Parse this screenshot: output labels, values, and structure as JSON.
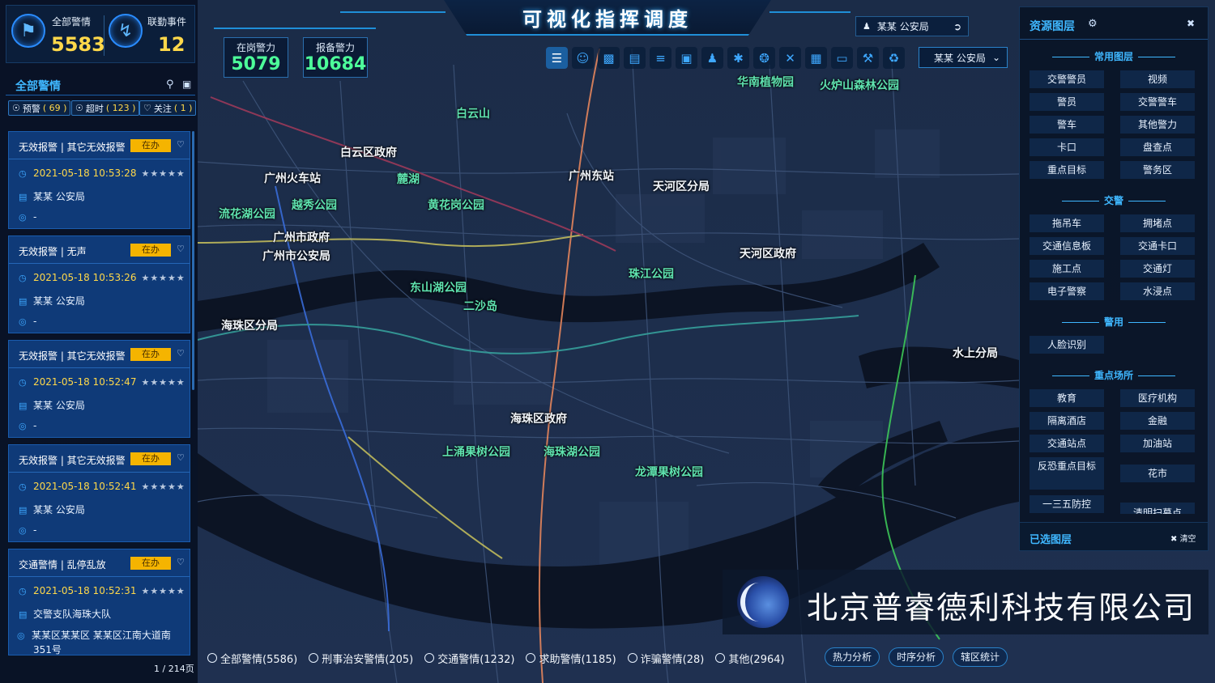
{
  "header": {
    "title": "可视化指挥调度",
    "user_label": "某某 公安局",
    "unit_select": "某某 公安局"
  },
  "stats": {
    "all_alarms_label": "全部警情",
    "all_alarms_value": "5583",
    "linked_events_label": "联勤事件",
    "linked_events_value": "12"
  },
  "police": {
    "on_duty_label": "在岗警力",
    "on_duty_value": "5079",
    "reported_label": "报备警力",
    "reported_value": "10684"
  },
  "alarm_panel": {
    "title": "全部警情",
    "filters": [
      {
        "label": "预警",
        "count": "( 69 )"
      },
      {
        "label": "超时",
        "count": "( 123 )"
      },
      {
        "label": "关注",
        "count": "( 1 )"
      }
    ],
    "cards": [
      {
        "title": "无效报警 | 其它无效报警",
        "badge": "在办",
        "time": "2021-05-18 10:53:28",
        "stars": "★★★★★",
        "unit": "某某 公安局",
        "address": "-"
      },
      {
        "title": "无效报警 | 无声",
        "badge": "在办",
        "time": "2021-05-18 10:53:26",
        "stars": "★★★★★",
        "unit": "某某 公安局",
        "address": "-"
      },
      {
        "title": "无效报警 | 其它无效报警",
        "badge": "在办",
        "time": "2021-05-18 10:52:47",
        "stars": "★★★★★",
        "unit": "某某 公安局",
        "address": "-"
      },
      {
        "title": "无效报警 | 其它无效报警",
        "badge": "在办",
        "time": "2021-05-18 10:52:41",
        "stars": "★★★★★",
        "unit": "某某 公安局",
        "address": "-"
      },
      {
        "title": "交通警情 | 乱停乱放",
        "badge": "在办",
        "time": "2021-05-18 10:52:31",
        "stars": "★★★★★",
        "unit": "交警支队海珠大队",
        "address": "某某区某某区 某某区江南大道南",
        "address2": "351号"
      }
    ],
    "pager": "1 / 214页"
  },
  "toolbar_icons": [
    "layers-icon",
    "portrait-icon",
    "bar-chart-icon",
    "report-icon",
    "list-icon",
    "chat-icon",
    "officer-icon",
    "bluetooth-icon",
    "drone-icon",
    "cross-icon",
    "grid-icon",
    "eraser-icon",
    "wrench-icon",
    "broom-icon"
  ],
  "resource_panel": {
    "title": "资源图层",
    "sections": [
      {
        "title": "常用图层",
        "items": [
          "交警警员",
          "视频",
          "警员",
          "交警警车",
          "警车",
          "其他警力",
          "卡口",
          "盘查点",
          "重点目标",
          "警务区"
        ]
      },
      {
        "title": "交警",
        "items": [
          "拖吊车",
          "拥堵点",
          "交通信息板",
          "交通卡口",
          "施工点",
          "交通灯",
          "电子警察",
          "水浸点"
        ]
      },
      {
        "title": "警用",
        "items": [
          "人脸识别"
        ]
      },
      {
        "title": "重点场所",
        "items": [
          "教育",
          "医疗机构",
          "隔离酒店",
          "金融",
          "交通站点",
          "加油站",
          "反恐重点目标",
          "花市",
          "一三五防控",
          "清明扫墓点"
        ]
      }
    ]
  },
  "selected_layers": {
    "title": "已选图层",
    "clear": "清空"
  },
  "map_labels": [
    {
      "text": "白云山",
      "tone": "green"
    },
    {
      "text": "华南植物园",
      "tone": "green"
    },
    {
      "text": "火炉山森林公园",
      "tone": "green"
    },
    {
      "text": "白云区政府",
      "tone": "white"
    },
    {
      "text": "广州火车站",
      "tone": "white"
    },
    {
      "text": "麓湖",
      "tone": "green"
    },
    {
      "text": "广州东站",
      "tone": "white"
    },
    {
      "text": "天河区分局",
      "tone": "white"
    },
    {
      "text": "流花湖公园",
      "tone": "green"
    },
    {
      "text": "越秀公园",
      "tone": "green"
    },
    {
      "text": "黄花岗公园",
      "tone": "green"
    },
    {
      "text": "广州市政府",
      "tone": "white"
    },
    {
      "text": "广州市公安局",
      "tone": "white"
    },
    {
      "text": "天河区政府",
      "tone": "white"
    },
    {
      "text": "珠江公园",
      "tone": "green"
    },
    {
      "text": "东山湖公园",
      "tone": "green"
    },
    {
      "text": "二沙岛",
      "tone": "green"
    },
    {
      "text": "海珠区分局",
      "tone": "white"
    },
    {
      "text": "水上分局",
      "tone": "white"
    },
    {
      "text": "海珠区政府",
      "tone": "white"
    },
    {
      "text": "上涌果树公园",
      "tone": "green"
    },
    {
      "text": "海珠湖公园",
      "tone": "green"
    },
    {
      "text": "龙潭果树公园",
      "tone": "green"
    }
  ],
  "bottom_filters": [
    "全部警情(5586)",
    "刑事治安警情(205)",
    "交通警情(1232)",
    "求助警情(1185)",
    "诈骗警情(28)",
    "其他(2964)"
  ],
  "analysis_buttons": [
    "热力分析",
    "时序分析",
    "辖区统计"
  ],
  "watermark": {
    "text": "北京普睿德利科技有限公司"
  },
  "colors": {
    "accent": "#3fb7ff",
    "stat_yellow": "#ffd84a",
    "stat_green": "#4dff9a",
    "badge": "#f5b400",
    "card": "#0f3a78"
  }
}
